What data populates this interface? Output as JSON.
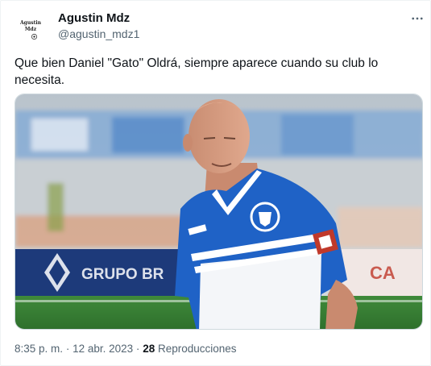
{
  "author": {
    "display_name": "Agustin Mdz",
    "handle": "@agustin_mdz1",
    "avatar_line1": "Agustin",
    "avatar_line2": "Mdz"
  },
  "tweet": {
    "text": "Que bien Daniel \"Gato\" Oldrá, siempre aparece cuando su club lo necesita.",
    "time": "8:35 p. m.",
    "separator": "·",
    "date": "12 abr. 2023",
    "views_count": "28",
    "views_label": "Reproducciones"
  },
  "media": {
    "banner_text": "GRUPO BR",
    "banner_text_right": "CA",
    "image_subject": "man in blue and white striped jersey"
  },
  "icons": {
    "more": "more-horizontal-icon"
  },
  "colors": {
    "text_primary": "#0f1419",
    "text_secondary": "#536471",
    "border": "#cfd9de",
    "jersey_blue": "#1f62c6"
  }
}
